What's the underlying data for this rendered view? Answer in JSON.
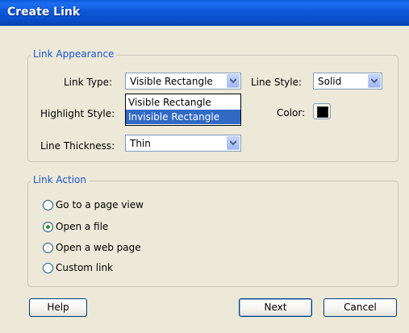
{
  "window": {
    "title": "Create Link"
  },
  "appearance": {
    "group_label": "Link Appearance",
    "link_type_label": "Link Type:",
    "link_type_value": "Visible Rectangle",
    "line_style_label": "Line Style:",
    "line_style_value": "Solid",
    "highlight_style_label": "Highlight Style:",
    "color_label": "Color:",
    "color_value": "#000000",
    "line_thickness_label": "Line Thickness:",
    "line_thickness_value": "Thin",
    "dropdown_options": [
      "Visible Rectangle",
      "Invisible Rectangle"
    ],
    "dropdown_highlighted": "Invisible Rectangle"
  },
  "action": {
    "group_label": "Link Action",
    "options": [
      {
        "label": "Go to a page view",
        "checked": false
      },
      {
        "label": "Open a file",
        "checked": true
      },
      {
        "label": "Open a web page",
        "checked": false
      },
      {
        "label": "Custom link",
        "checked": false
      }
    ]
  },
  "buttons": {
    "help": "Help",
    "next": "Next",
    "cancel": "Cancel"
  },
  "icons": {
    "dropdown_arrow": "chevron-down-icon"
  },
  "colors": {
    "title_bar": "#0a5bd9",
    "group_label": "#1c54c9",
    "selection": "#316ac5",
    "dialog_bg": "#ece9d8"
  }
}
